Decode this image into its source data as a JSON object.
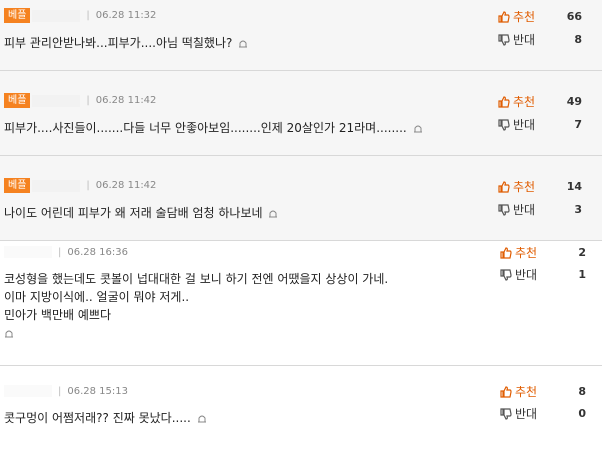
{
  "up_label": "추천",
  "down_label": "반대",
  "comments": [
    {
      "badge": "베플",
      "date": "06.28 11:32",
      "lines": [
        "피부 관리안받나봐...피부가....아님 떡칠했나?"
      ],
      "up": "66",
      "down": "8"
    },
    {
      "badge": "베플",
      "date": "06.28 11:42",
      "lines": [
        "피부가....사진들이.......다들 너무 안좋아보임........인제 20살인가 21라며........"
      ],
      "up": "49",
      "down": "7"
    },
    {
      "badge": "베플",
      "date": "06.28 11:42",
      "lines": [
        "나이도 어린데 피부가 왜 저래 술담배 엄청 하나보네"
      ],
      "up": "14",
      "down": "3"
    },
    {
      "badge": "",
      "date": "06.28 16:36",
      "lines": [
        "코성형을 했는데도 콧볼이 넙대대한 걸 보니 하기 전엔 어땠을지 상상이 가네.",
        "이마 지방이식에.. 얼굴이 뭐야 저게..",
        "민아가 백만배 예쁘다"
      ],
      "up": "2",
      "down": "1"
    },
    {
      "badge": "",
      "date": "06.28 15:13",
      "lines": [
        "콧구멍이 어쩜저래?? 진짜 못났다....."
      ],
      "up": "8",
      "down": "0"
    }
  ],
  "colors": {
    "badge": "#f58220",
    "up": "#e05c00"
  }
}
